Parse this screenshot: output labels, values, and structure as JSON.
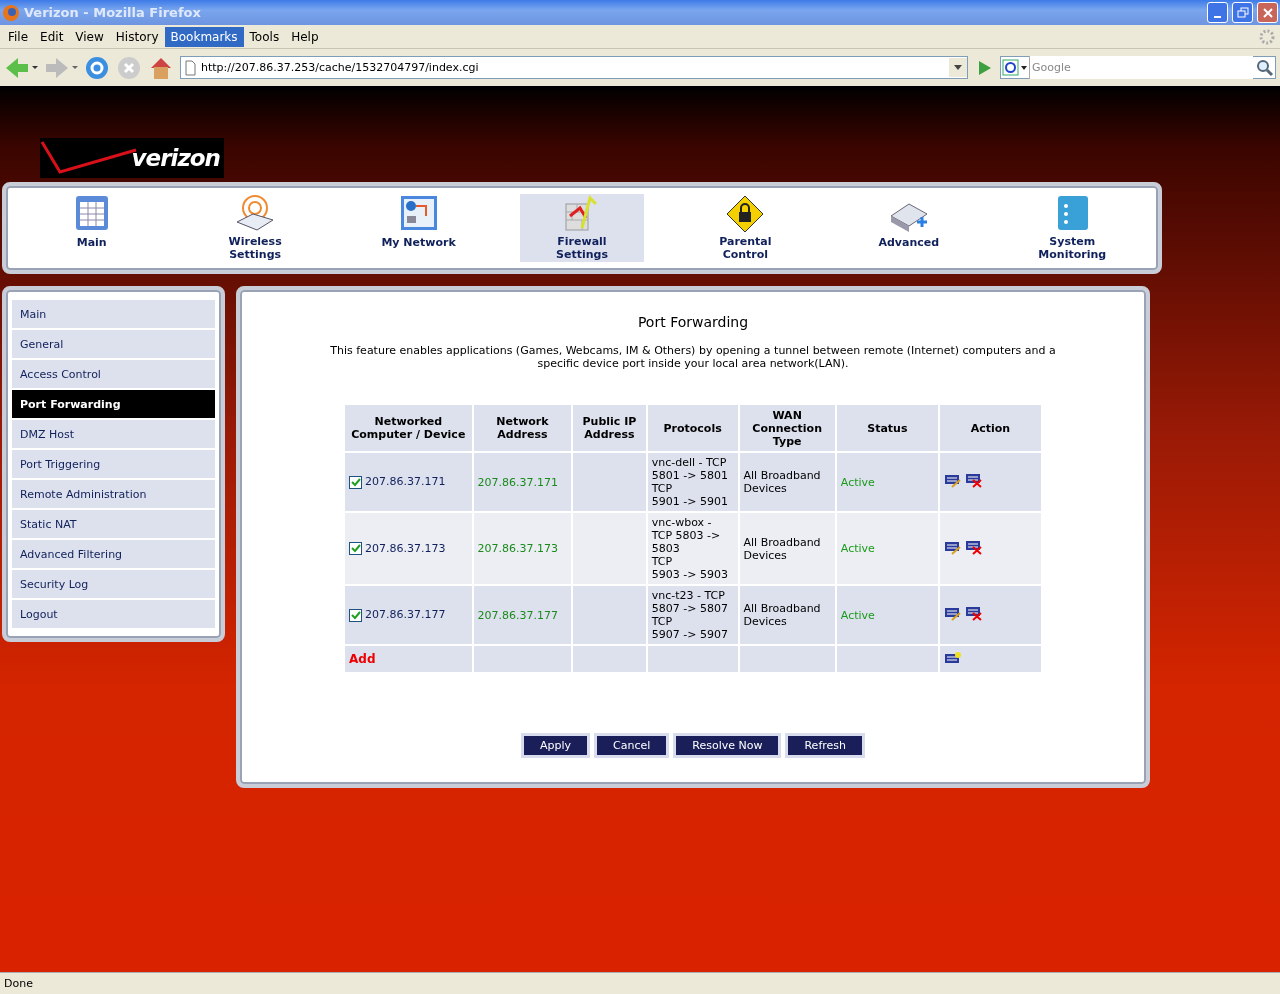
{
  "window": {
    "title": "Verizon - Mozilla Firefox"
  },
  "menu": [
    {
      "label": "File",
      "selected": false
    },
    {
      "label": "Edit",
      "selected": false
    },
    {
      "label": "View",
      "selected": false
    },
    {
      "label": "History",
      "selected": false
    },
    {
      "label": "Bookmarks",
      "selected": true
    },
    {
      "label": "Tools",
      "selected": false
    },
    {
      "label": "Help",
      "selected": false
    }
  ],
  "address_bar": {
    "value": "http://207.86.37.253/cache/1532704797/index.cgi"
  },
  "search": {
    "placeholder": "Google"
  },
  "logo": {
    "text": "verizon"
  },
  "top_nav": [
    {
      "label": "Main",
      "kind": "main",
      "selected": false
    },
    {
      "label": "Wireless Settings",
      "kind": "wireless",
      "selected": false
    },
    {
      "label": "My Network",
      "kind": "network",
      "selected": false
    },
    {
      "label": "Firewall Settings",
      "kind": "firewall",
      "selected": true
    },
    {
      "label": "Parental Control",
      "kind": "parental",
      "selected": false
    },
    {
      "label": "Advanced",
      "kind": "advanced",
      "selected": false
    },
    {
      "label": "System Monitoring",
      "kind": "monitor",
      "selected": false
    }
  ],
  "sidebar": {
    "items": [
      {
        "label": "Main",
        "selected": false
      },
      {
        "label": "General",
        "selected": false
      },
      {
        "label": "Access Control",
        "selected": false
      },
      {
        "label": "Port Forwarding",
        "selected": true
      },
      {
        "label": "DMZ Host",
        "selected": false
      },
      {
        "label": "Port Triggering",
        "selected": false
      },
      {
        "label": "Remote Administration",
        "selected": false
      },
      {
        "label": "Static NAT",
        "selected": false
      },
      {
        "label": "Advanced Filtering",
        "selected": false
      },
      {
        "label": "Security Log",
        "selected": false
      },
      {
        "label": "Logout",
        "selected": false
      }
    ]
  },
  "content": {
    "title": "Port Forwarding",
    "description": "This feature enables applications (Games, Webcams, IM & Others) by opening a tunnel between remote (Internet) computers and a specific device port inside your local area network(LAN).",
    "table": {
      "columns": [
        "Networked Computer / Device",
        "Network Address",
        "Public IP Address",
        "Protocols",
        "WAN Connection Type",
        "Status",
        "Action"
      ],
      "rows": [
        {
          "checked": true,
          "device": "207.86.37.171",
          "address": "207.86.37.171",
          "protocols": [
            "vnc-dell - TCP",
            "5801 -> 5801",
            "TCP",
            "5901 -> 5901"
          ],
          "wan": "All Broadband Devices",
          "status": "Active"
        },
        {
          "checked": true,
          "device": "207.86.37.173",
          "address": "207.86.37.173",
          "protocols": [
            "vnc-wbox -",
            "TCP 5803 ->",
            "5803",
            "TCP",
            "5903 -> 5903"
          ],
          "wan": "All Broadband Devices",
          "status": "Active"
        },
        {
          "checked": true,
          "device": "207.86.37.177",
          "address": "207.86.37.177",
          "protocols": [
            "vnc-t23 - TCP",
            "5807 -> 5807",
            "TCP",
            "5907 -> 5907"
          ],
          "wan": "All Broadband Devices",
          "status": "Active"
        }
      ],
      "add_label": "Add"
    },
    "buttons": [
      "Apply",
      "Cancel",
      "Resolve Now",
      "Refresh"
    ]
  },
  "status_bar": {
    "text": "Done"
  }
}
